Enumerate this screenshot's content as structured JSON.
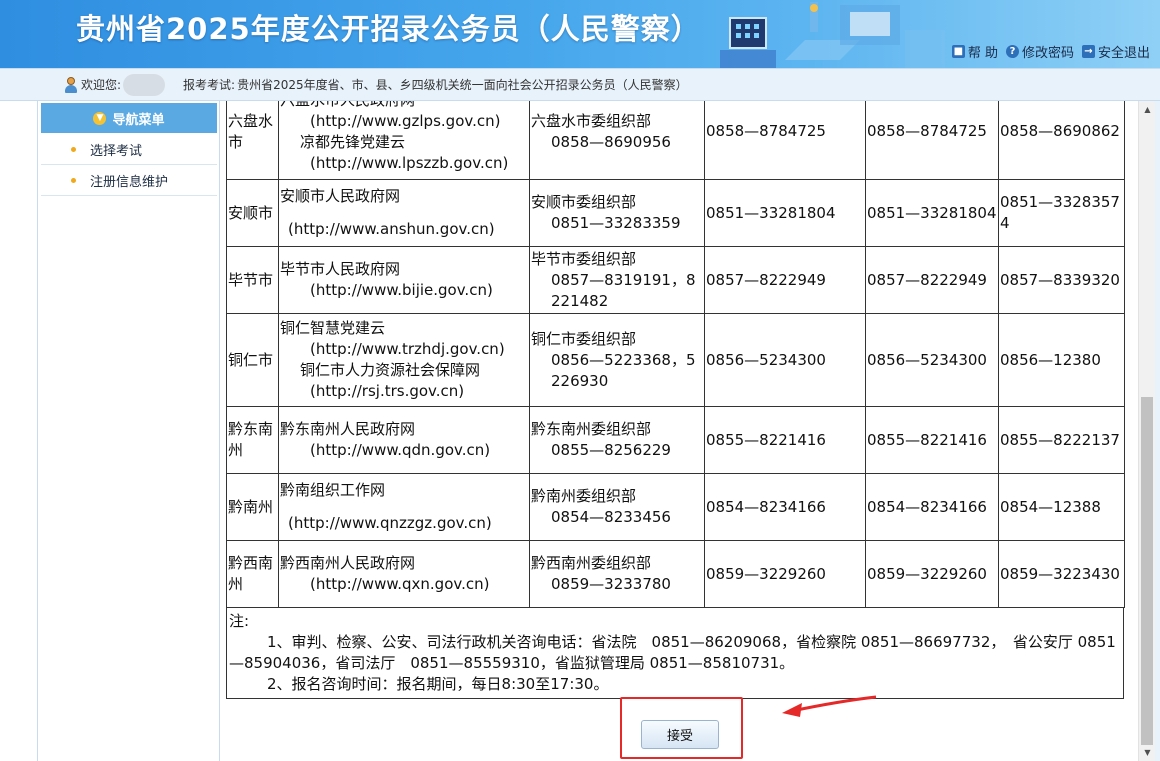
{
  "header": {
    "title": "贵州省2025年度公开招录公务员（人民警察）",
    "links": [
      {
        "label": "帮 助",
        "icon": "lock-icon"
      },
      {
        "label": "修改密码",
        "icon": "help-circle-icon"
      },
      {
        "label": "安全退出",
        "icon": "logout-icon"
      }
    ]
  },
  "infobar": {
    "welcome": "欢迎您:",
    "exam_label": "报考考试:",
    "exam_value": "贵州省2025年度省、市、县、乡四级机关统一面向社会公开招录公务员（人民警察）"
  },
  "sidebar": {
    "title": "导航菜单",
    "items": [
      "选择考试",
      "注册信息维护"
    ]
  },
  "table": {
    "rows": [
      {
        "city": "六盘水市",
        "site": [
          "六盘水市人民政府网",
          "(http://www.gzlps.gov.cn)",
          "凉都先锋党建云",
          "(http://www.lpszzb.gov.cn)"
        ],
        "org": [
          "六盘水市委组织部",
          "0858—8690956"
        ],
        "p1": "0858—8784725",
        "p2": "0858—8784725",
        "p3": "0858—8690862"
      },
      {
        "city": "安顺市",
        "site": [
          "安顺市人民政府网",
          "(http://www.anshun.gov.cn)"
        ],
        "org": [
          "安顺市委组织部",
          "0851—33283359"
        ],
        "p1": "0851—33281804",
        "p2": "0851—33281804",
        "p3": "0851—33283574"
      },
      {
        "city": "毕节市",
        "site": [
          "毕节市人民政府网",
          "(http://www.bijie.gov.cn)"
        ],
        "org": [
          "毕节市委组织部",
          "0857—8319191，8221482"
        ],
        "p1": "0857—8222949",
        "p2": "0857—8222949",
        "p3": "0857—8339320"
      },
      {
        "city": "铜仁市",
        "site": [
          "铜仁智慧党建云",
          "(http://www.trzhdj.gov.cn)",
          "铜仁市人力资源社会保障网",
          "(http://rsj.trs.gov.cn)"
        ],
        "org": [
          "铜仁市委组织部",
          "0856—5223368，5226930"
        ],
        "p1": "0856—5234300",
        "p2": "0856—5234300",
        "p3": "0856—12380"
      },
      {
        "city": "黔东南州",
        "site": [
          "黔东南州人民政府网",
          "(http://www.qdn.gov.cn)"
        ],
        "org": [
          "黔东南州委组织部",
          "0855—8256229"
        ],
        "p1": "0855—8221416",
        "p2": "0855—8221416",
        "p3": "0855—8222137"
      },
      {
        "city": "黔南州",
        "site": [
          "黔南组织工作网",
          "(http://www.qnzzgz.gov.cn)"
        ],
        "org": [
          "黔南州委组织部",
          "0854—8233456"
        ],
        "p1": "0854—8234166",
        "p2": "0854—8234166",
        "p3": "0854—12388"
      },
      {
        "city": "黔西南州",
        "site": [
          "黔西南州人民政府网",
          "(http://www.qxn.gov.cn)"
        ],
        "org": [
          "黔西南州委组织部",
          "0859—3233780"
        ],
        "p1": "0859—3229260",
        "p2": "0859—3229260",
        "p3": "0859—3223430"
      }
    ]
  },
  "notes": {
    "title": "注:",
    "line1": "1、审判、检察、公安、司法行政机关咨询电话：省法院　0851—86209068，省检察院 0851—86697732，　省公安厅 0851—85904036，省司法厅　0851—85559310，省监狱管理局 0851—85810731。",
    "line2": "2、报名咨询时间：报名期间，每日8:30至17:30。"
  },
  "accept_label": "接受"
}
